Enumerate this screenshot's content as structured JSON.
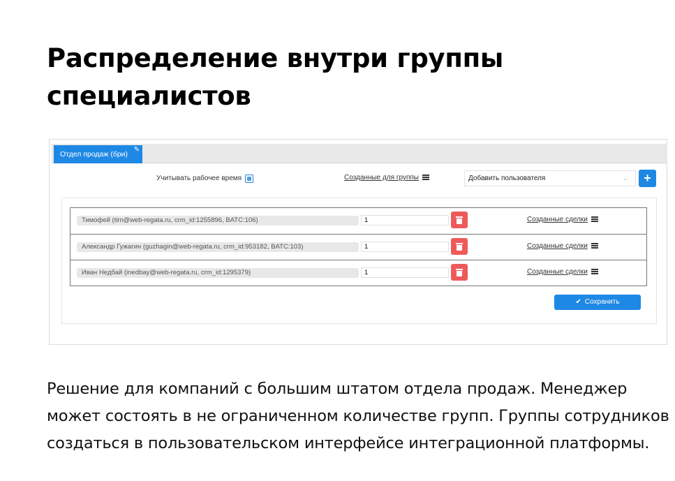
{
  "heading": "Распределение внутри группы специалистов",
  "screenshot": {
    "tab": {
      "label": "Отдел продаж (бри)",
      "icon": "edit-icon"
    },
    "toolbar": {
      "work_time_label": "Учитывать рабочее время",
      "work_time_checked": true,
      "group_link": "Созданные для группы",
      "add_user_placeholder": "Добавить пользователя",
      "add_button": "+"
    },
    "rows": [
      {
        "name": "Тимофей (tim@web-regata.ru, crm_id:1255896, BATC:106)",
        "qty": "1",
        "deals_link": "Созданные сделки"
      },
      {
        "name": "Александр Гужагин (guzhagin@web-regata.ru, crm_id:953182, BATC:103)",
        "qty": "1",
        "deals_link": "Созданные сделки"
      },
      {
        "name": "Иван Недбай (inedbay@web-regata.ru, crm_id:1295379)",
        "qty": "1",
        "deals_link": "Созданные сделки"
      }
    ],
    "save_button": "Сохранить",
    "colors": {
      "primary": "#1e88e5",
      "danger": "#ee5a5a"
    }
  },
  "description": "Решение для компаний с большим штатом отдела продаж. Менеджер может состоять в не ограниченном количестве групп. Группы сотрудников создаться в пользовательском интерфейсе интеграционной платформы."
}
